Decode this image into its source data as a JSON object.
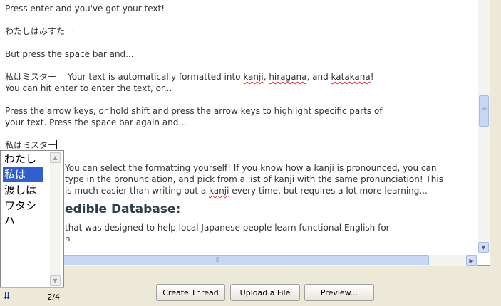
{
  "editor": {
    "line_enter": "Press enter and you've got your text!",
    "hiragana_sample": "わたしはみすたー",
    "line_space": "But press the space bar and...",
    "kanji_sample": "私はミスター",
    "auto_format_prefix": "Your text is automatically formatted into ",
    "word_kanji": "kanji",
    "comma1": ", ",
    "word_hiragana": "hiragana",
    "and_text": ", and ",
    "word_katakana": "katakana",
    "exclaim": "!",
    "line_hit_enter": "You can hit enter to enter the text, or...",
    "line_arrow_1": "Press the arrow keys, or hold shift and press the arrow keys to highlight specific parts of",
    "line_arrow_2": "your text. Press the space bar again and...",
    "composition": "私はミスター",
    "select_1": "You can select the formatting yourself! If you know how a kanji is pronounced, you can",
    "select_2": "type in the pronunciation, and pick from a list of kanji with the same pronunciation! This",
    "select_3a": "is much easier than writing out a ",
    "select_3_kanji": "kanji",
    "select_3b": " every time, but requires a lot more learning...",
    "db_heading": "edible Database:",
    "db_line": "that was designed to help local Japanese people learn functional English for",
    "db_line_clipped": "n"
  },
  "ime": {
    "candidates": [
      "わたしは",
      "私は",
      "渡しは",
      "ワタシハ"
    ],
    "selected_index": 1,
    "counter": "2/4",
    "icon": "ime-list-icon"
  },
  "buttons": {
    "create_thread": "Create Thread",
    "upload_file": "Upload a File",
    "preview": "Preview..."
  }
}
